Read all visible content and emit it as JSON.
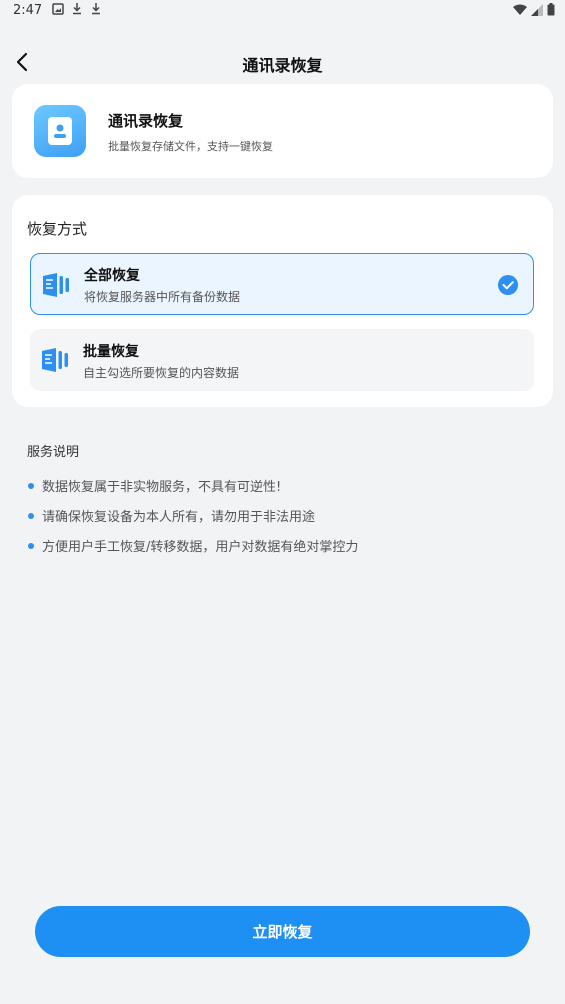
{
  "status_bar": {
    "time": "2:47"
  },
  "nav": {
    "title": "通讯录恢复"
  },
  "header_card": {
    "title": "通讯录恢复",
    "subtitle": "批量恢复存储文件，支持一键恢复"
  },
  "method": {
    "section_title": "恢复方式",
    "options": [
      {
        "title": "全部恢复",
        "subtitle": "将恢复服务器中所有备份数据",
        "selected": true
      },
      {
        "title": "批量恢复",
        "subtitle": "自主勾选所要恢复的内容数据",
        "selected": false
      }
    ]
  },
  "notes": {
    "title": "服务说明",
    "items": [
      "数据恢复属于非实物服务，不具有可逆性!",
      "请确保恢复设备为本人所有，请勿用于非法用途",
      "方便用户手工恢复/转移数据，用户对数据有绝对掌控力"
    ]
  },
  "action": {
    "label": "立即恢复"
  },
  "colors": {
    "accent": "#1e8ff3",
    "background": "#f2f3f5"
  }
}
